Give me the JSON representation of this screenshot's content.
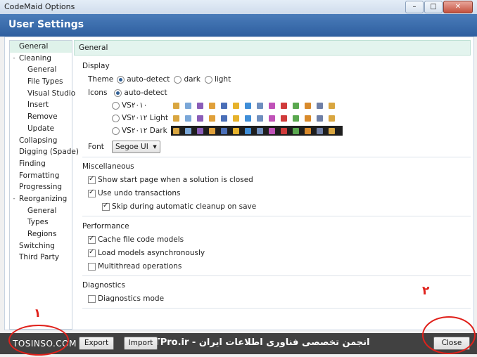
{
  "window": {
    "title": "CodeMaid Options",
    "buttons": [
      "minimize",
      "maximize",
      "close"
    ]
  },
  "header": {
    "title": "User Settings"
  },
  "sidebar": {
    "items": [
      {
        "label": "General",
        "selected": true
      },
      {
        "label": "Cleaning",
        "expander": "-"
      },
      {
        "label": "General",
        "child": true
      },
      {
        "label": "File Types",
        "child": true
      },
      {
        "label": "Visual Studio",
        "child": true
      },
      {
        "label": "Insert",
        "child": true
      },
      {
        "label": "Remove",
        "child": true
      },
      {
        "label": "Update",
        "child": true
      },
      {
        "label": "Collapsing"
      },
      {
        "label": "Digging (Spade)"
      },
      {
        "label": "Finding"
      },
      {
        "label": "Formatting"
      },
      {
        "label": "Progressing"
      },
      {
        "label": "Reorganizing",
        "expander": "-"
      },
      {
        "label": "General",
        "child": true
      },
      {
        "label": "Types",
        "child": true
      },
      {
        "label": "Regions",
        "child": true
      },
      {
        "label": "Switching"
      },
      {
        "label": "Third Party"
      }
    ]
  },
  "panel": {
    "title": "General",
    "display": {
      "title": "Display",
      "theme_label": "Theme",
      "theme_options": [
        "auto-detect",
        "dark",
        "light"
      ],
      "icons_label": "Icons",
      "icons_options": [
        "auto-detect",
        "VS۲۰۱۰",
        "VS۲۰۱۲ Light",
        "VS۲۰۱۲ Dark"
      ],
      "font_label": "Font",
      "font_value": "Segoe UI"
    },
    "misc": {
      "title": "Miscellaneous",
      "show_start_page": "Show start page when a solution is closed",
      "undo_transactions": "Use undo transactions",
      "skip_cleanup": "Skip during automatic cleanup on save"
    },
    "performance": {
      "title": "Performance",
      "cache_models": "Cache file code models",
      "load_async": "Load models asynchronously",
      "multithread": "Multithread operations"
    },
    "diagnostics": {
      "title": "Diagnostics",
      "mode": "Diagnostics mode"
    }
  },
  "footer": {
    "export_label": "Export",
    "import_label": "Import",
    "close_label": "Close"
  },
  "watermark": {
    "left": "TOSINSO.COM",
    "right": "ITPro.ir - انجمن تخصصی فناوری اطلاعات ایران"
  },
  "annotations": {
    "one": "۱",
    "two": "۲"
  },
  "icon_colors": {
    "strip": [
      "#d9a640",
      "#7aa7d8",
      "#8a5db8",
      "#e0a03a",
      "#4a6fb8",
      "#e6b22b",
      "#3f8ed8",
      "#6f8fbf",
      "#c052b8",
      "#d03b3b",
      "#5aa84f",
      "#d98a2b",
      "#6f7fa6",
      "#d9a640"
    ]
  }
}
